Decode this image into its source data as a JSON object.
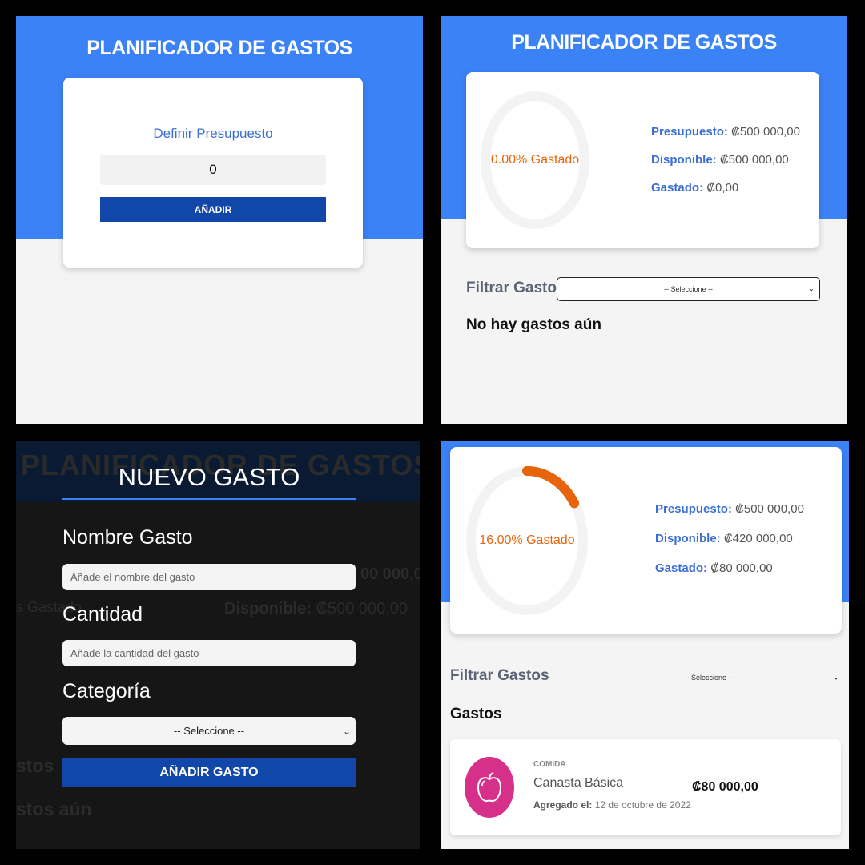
{
  "app": {
    "title": "PLANIFICADOR DE GASTOS"
  },
  "budget_form": {
    "label": "Definir Presupuesto",
    "input_value": "0",
    "button_label": "AÑADIR"
  },
  "control_initial": {
    "percent_label": "0.00% Gastado",
    "percent": 0,
    "presupuesto_label": "Presupuesto:",
    "presupuesto_value": "₡500 000,00",
    "disponible_label": "Disponible:",
    "disponible_value": "₡500 000,00",
    "gastado_label": "Gastado:",
    "gastado_value": "₡0,00",
    "filter_label": "Filtrar Gastos",
    "filter_selected": "-- Seleccione --",
    "empty_message": "No hay gastos aún"
  },
  "modal": {
    "title": "NUEVO GASTO",
    "name_label": "Nombre Gasto",
    "name_placeholder": "Añade el nombre del gasto",
    "amount_label": "Cantidad",
    "amount_placeholder": "Añade la cantidad del gasto",
    "category_label": "Categoría",
    "category_selected": "-- Seleccione --",
    "submit_label": "AÑADIR GASTO",
    "background": {
      "title": "PLANIFICADOR DE GASTOS",
      "presupuesto_fragment": "00 000,0",
      "gastado_fragment": "s Gastado",
      "disponible_label": "Disponible:",
      "disponible_value": "₡500 000,00",
      "filter_fragment": "stos",
      "empty_fragment": "stos aún"
    }
  },
  "control_after": {
    "percent_label": "16.00% Gastado",
    "percent": 16,
    "presupuesto_label": "Presupuesto:",
    "presupuesto_value": "₡500 000,00",
    "disponible_label": "Disponible:",
    "disponible_value": "₡420 000,00",
    "gastado_label": "Gastado:",
    "gastado_value": "₡80 000,00",
    "filter_label": "Filtrar Gastos",
    "filter_selected": "-- Seleccione --",
    "list_heading": "Gastos",
    "expenses": [
      {
        "category": "COMIDA",
        "name": "Canasta Básica",
        "date_label": "Agregado el:",
        "date": "12 de octubre de 2022",
        "amount": "₡80 000,00",
        "icon": "apple-icon"
      }
    ]
  },
  "colors": {
    "brand_blue": "#3b82f6",
    "button_blue": "#1047a8",
    "progress_orange": "#e8640c",
    "ring_track": "#f3f3f3",
    "food_pink": "#d6308a"
  }
}
